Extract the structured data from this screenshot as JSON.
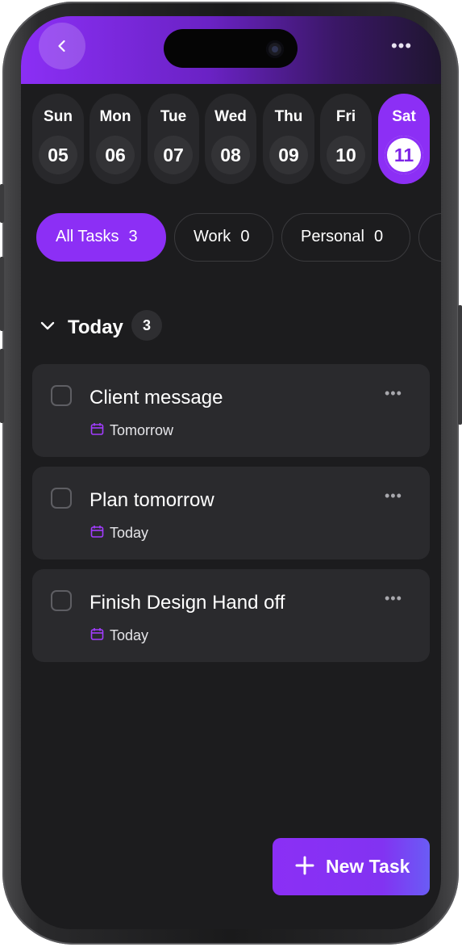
{
  "header": {
    "back_icon": "chevron-left-icon",
    "more_icon": "more-horizontal-icon",
    "more_glyph": "•••"
  },
  "days": [
    {
      "name": "Sun",
      "num": "05"
    },
    {
      "name": "Mon",
      "num": "06"
    },
    {
      "name": "Tue",
      "num": "07"
    },
    {
      "name": "Wed",
      "num": "08"
    },
    {
      "name": "Thu",
      "num": "09"
    },
    {
      "name": "Fri",
      "num": "10"
    },
    {
      "name": "Sat",
      "num": "11",
      "selected": true
    }
  ],
  "filters": [
    {
      "label": "All Tasks",
      "count": "3",
      "active": true
    },
    {
      "label": "Work",
      "count": "0"
    },
    {
      "label": "Personal",
      "count": "0"
    }
  ],
  "section": {
    "title": "Today",
    "count": "3",
    "icon": "chevron-down-icon"
  },
  "tasks": [
    {
      "title": "Client message",
      "due": "Tomorrow",
      "more": "•••"
    },
    {
      "title": "Plan tomorrow",
      "due": "Today",
      "more": "•••"
    },
    {
      "title": "Finish Design Hand off",
      "due": "Today",
      "more": "•••"
    }
  ],
  "fab": {
    "label": "New Task",
    "icon": "plus-icon"
  },
  "colors": {
    "accent": "#8c2ff5",
    "background": "#1c1c1e",
    "card": "#2a2a2d"
  }
}
